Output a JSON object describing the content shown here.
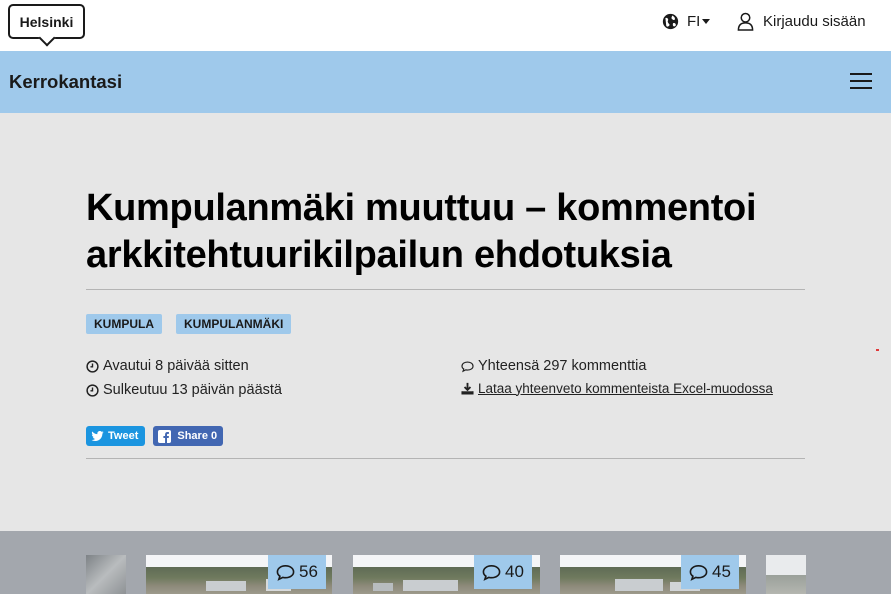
{
  "header": {
    "logo_text": "Helsinki",
    "language": "FI",
    "login_label": "Kirjaudu sisään"
  },
  "nav": {
    "site_title": "Kerrokantasi"
  },
  "hearing": {
    "title": "Kumpulanmäki muuttuu – kommentoi arkkitehtuurikilpailun ehdotuksia",
    "tags": [
      "KUMPULA",
      "KUMPULANMÄKI"
    ],
    "opened": "Avautui 8 päivää sitten",
    "closes": "Sulkeutuu 13 päivän päästä",
    "comment_total": "Yhteensä 297 kommenttia",
    "download_link": "Lataa yhteenveto kommenteista Excel-muodossa"
  },
  "social": {
    "tweet_label": "Tweet",
    "share_label": "Share 0"
  },
  "gallery": {
    "items": [
      {
        "comments": "56"
      },
      {
        "comments": "40"
      },
      {
        "comments": "45"
      }
    ]
  },
  "colors": {
    "nav_blue": "#9fc9eb",
    "hero_grey": "#e6e6e6",
    "gallery_grey": "#a3a7ad",
    "twitter_blue": "#1b95e0",
    "facebook_blue": "#4267b2"
  },
  "icons": [
    "globe-icon",
    "user-icon",
    "menu-icon",
    "clock-icon",
    "comment-icon",
    "download-icon",
    "twitter-icon",
    "facebook-icon"
  ]
}
